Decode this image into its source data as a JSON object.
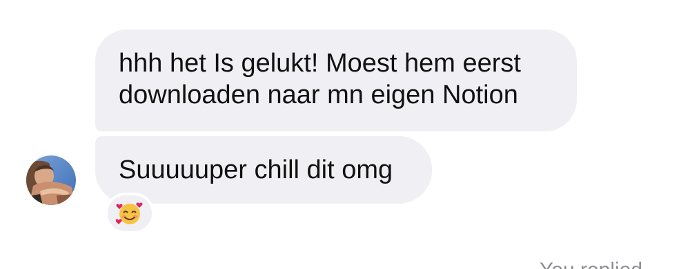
{
  "conversation": {
    "messages": [
      {
        "lines": [
          "hhh het Is gelukt! Moest hem eerst",
          "downloaden naar mn eigen Notion"
        ]
      },
      {
        "lines": [
          "Suuuuuper chill dit omg"
        ],
        "reaction": {
          "icon": "smiling-face-with-hearts-icon"
        }
      }
    ],
    "sender": {
      "avatar_icon": "profile-photo-avatar"
    },
    "footer_text": "You replied"
  },
  "colors": {
    "bubble_background": "#efeff4",
    "message_text": "#111111",
    "secondary_text": "#8e8e93"
  }
}
